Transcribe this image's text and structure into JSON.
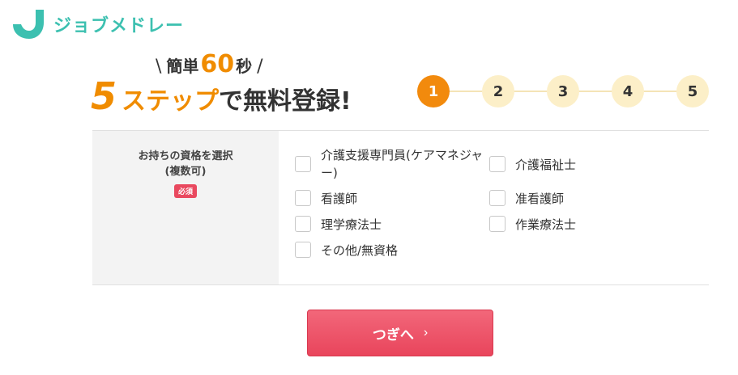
{
  "logo": {
    "text": "ジョブメドレー",
    "icon": "logo-mark-icon",
    "color": "#3cc0b0"
  },
  "catch": {
    "top_prefix": "簡単",
    "top_number": "60",
    "top_suffix": "秒",
    "slash_left": "\\",
    "slash_right": "/",
    "main_number": "5",
    "main_orange": "ステップ",
    "main_dark": "で無料登録!"
  },
  "steps": {
    "current": 1,
    "items": [
      "1",
      "2",
      "3",
      "4",
      "5"
    ],
    "active_color": "#f28a0d",
    "inactive_color": "#fcefc8"
  },
  "form": {
    "label_line1": "お持ちの資格を選択",
    "label_line2": "(複数可)",
    "required_badge": "必須",
    "options": [
      {
        "label": "介護支援専門員(ケアマネジャー)",
        "checked": false
      },
      {
        "label": "介護福祉士",
        "checked": false
      },
      {
        "label": "看護師",
        "checked": false
      },
      {
        "label": "准看護師",
        "checked": false
      },
      {
        "label": "理学療法士",
        "checked": false
      },
      {
        "label": "作業療法士",
        "checked": false
      },
      {
        "label": "その他/無資格",
        "checked": false
      }
    ]
  },
  "next_button": {
    "label": "つぎへ",
    "icon": "chevron-right-icon",
    "color": "#e9455c"
  }
}
